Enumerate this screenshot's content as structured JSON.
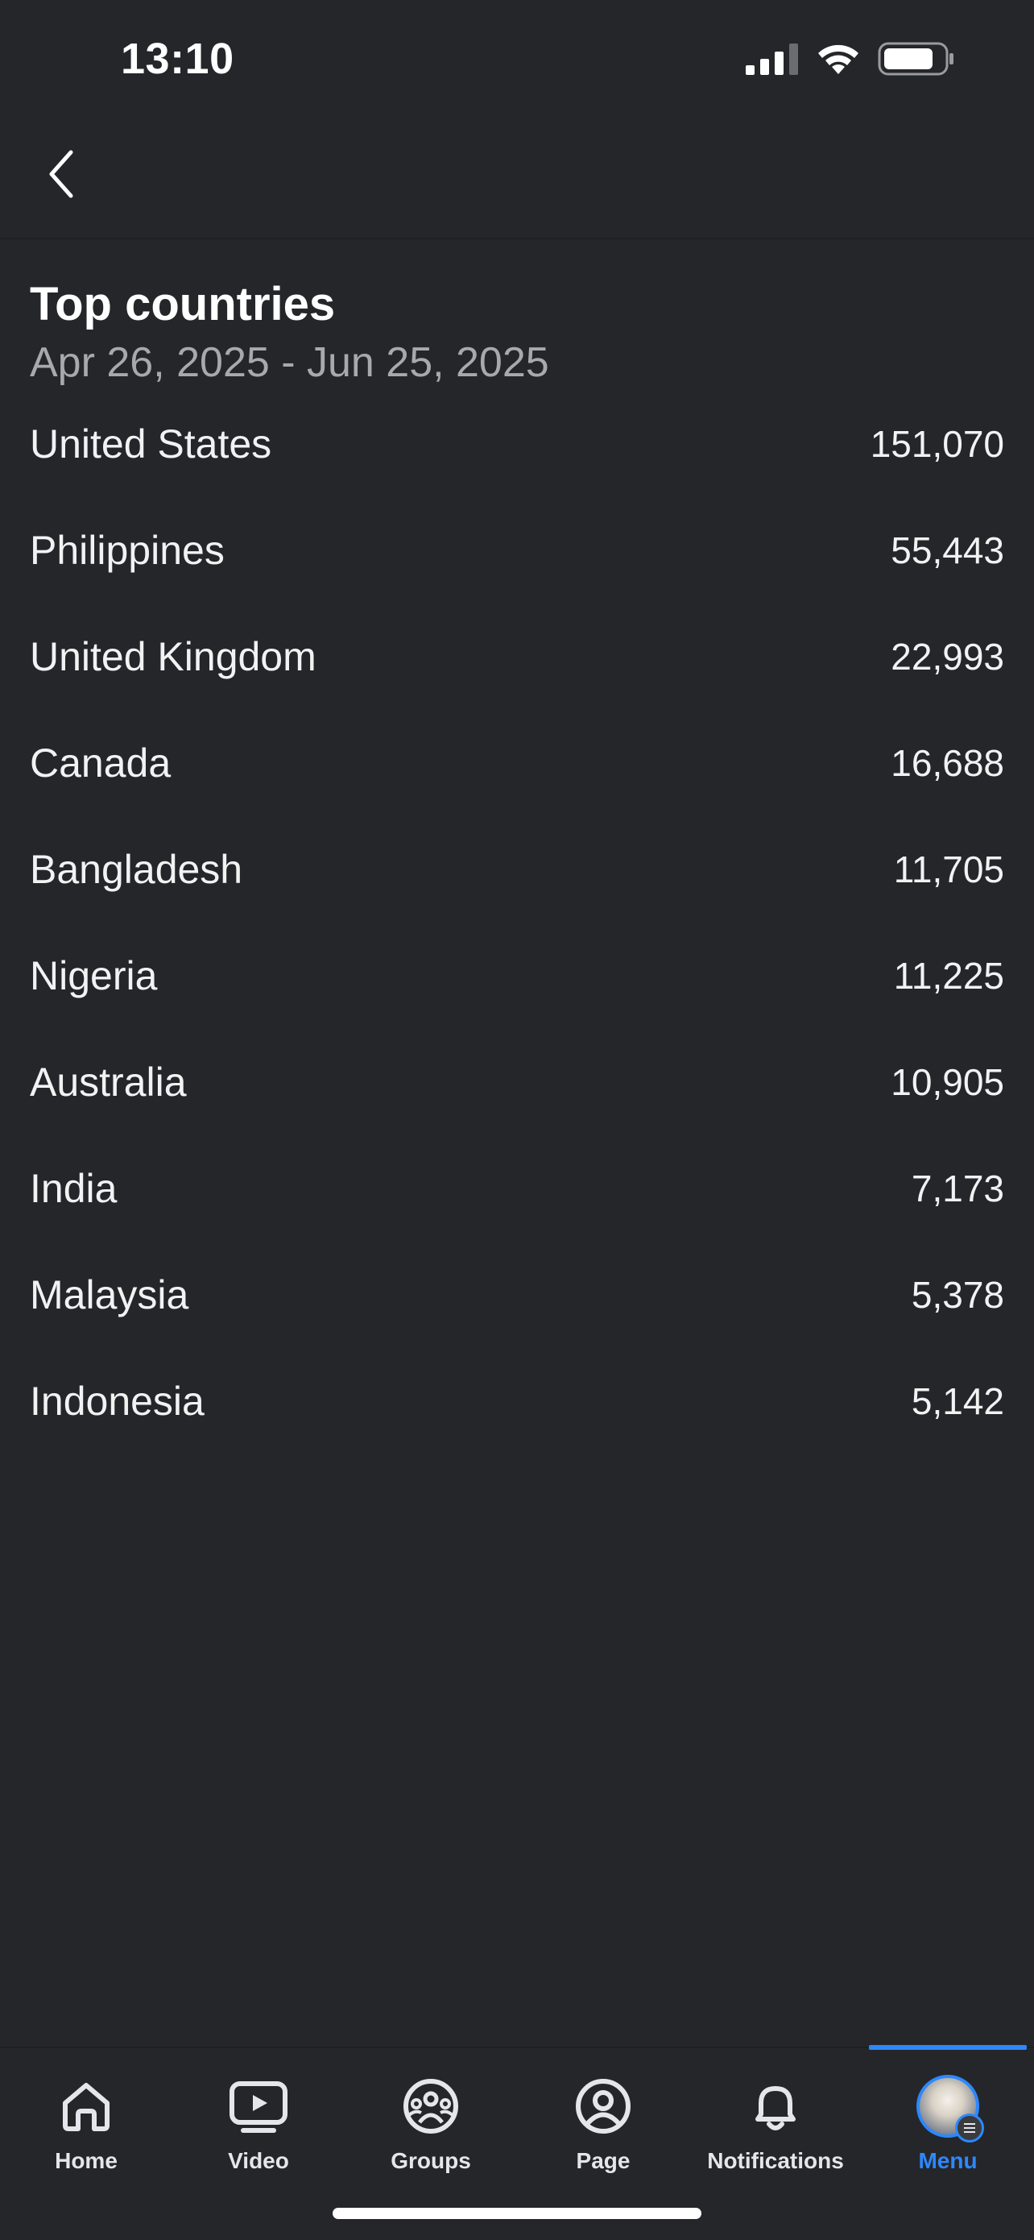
{
  "status_bar": {
    "time": "13:10"
  },
  "header": {
    "back_icon": "chevron-left-icon"
  },
  "main": {
    "title": "Top countries",
    "date_range": "Apr 26, 2025 - Jun 25, 2025",
    "countries": [
      {
        "name": "United States",
        "value": "151,070"
      },
      {
        "name": "Philippines",
        "value": "55,443"
      },
      {
        "name": "United Kingdom",
        "value": "22,993"
      },
      {
        "name": "Canada",
        "value": "16,688"
      },
      {
        "name": "Bangladesh",
        "value": "11,705"
      },
      {
        "name": "Nigeria",
        "value": "11,225"
      },
      {
        "name": "Australia",
        "value": "10,905"
      },
      {
        "name": "India",
        "value": "7,173"
      },
      {
        "name": "Malaysia",
        "value": "5,378"
      },
      {
        "name": "Indonesia",
        "value": "5,142"
      }
    ]
  },
  "tab_bar": {
    "active": "Menu",
    "accent_color": "#2d88ff",
    "tabs": [
      {
        "label": "Home",
        "icon": "home-icon"
      },
      {
        "label": "Video",
        "icon": "video-icon"
      },
      {
        "label": "Groups",
        "icon": "groups-icon"
      },
      {
        "label": "Page",
        "icon": "page-icon"
      },
      {
        "label": "Notifications",
        "icon": "bell-icon"
      },
      {
        "label": "Menu",
        "icon": "avatar"
      }
    ]
  }
}
